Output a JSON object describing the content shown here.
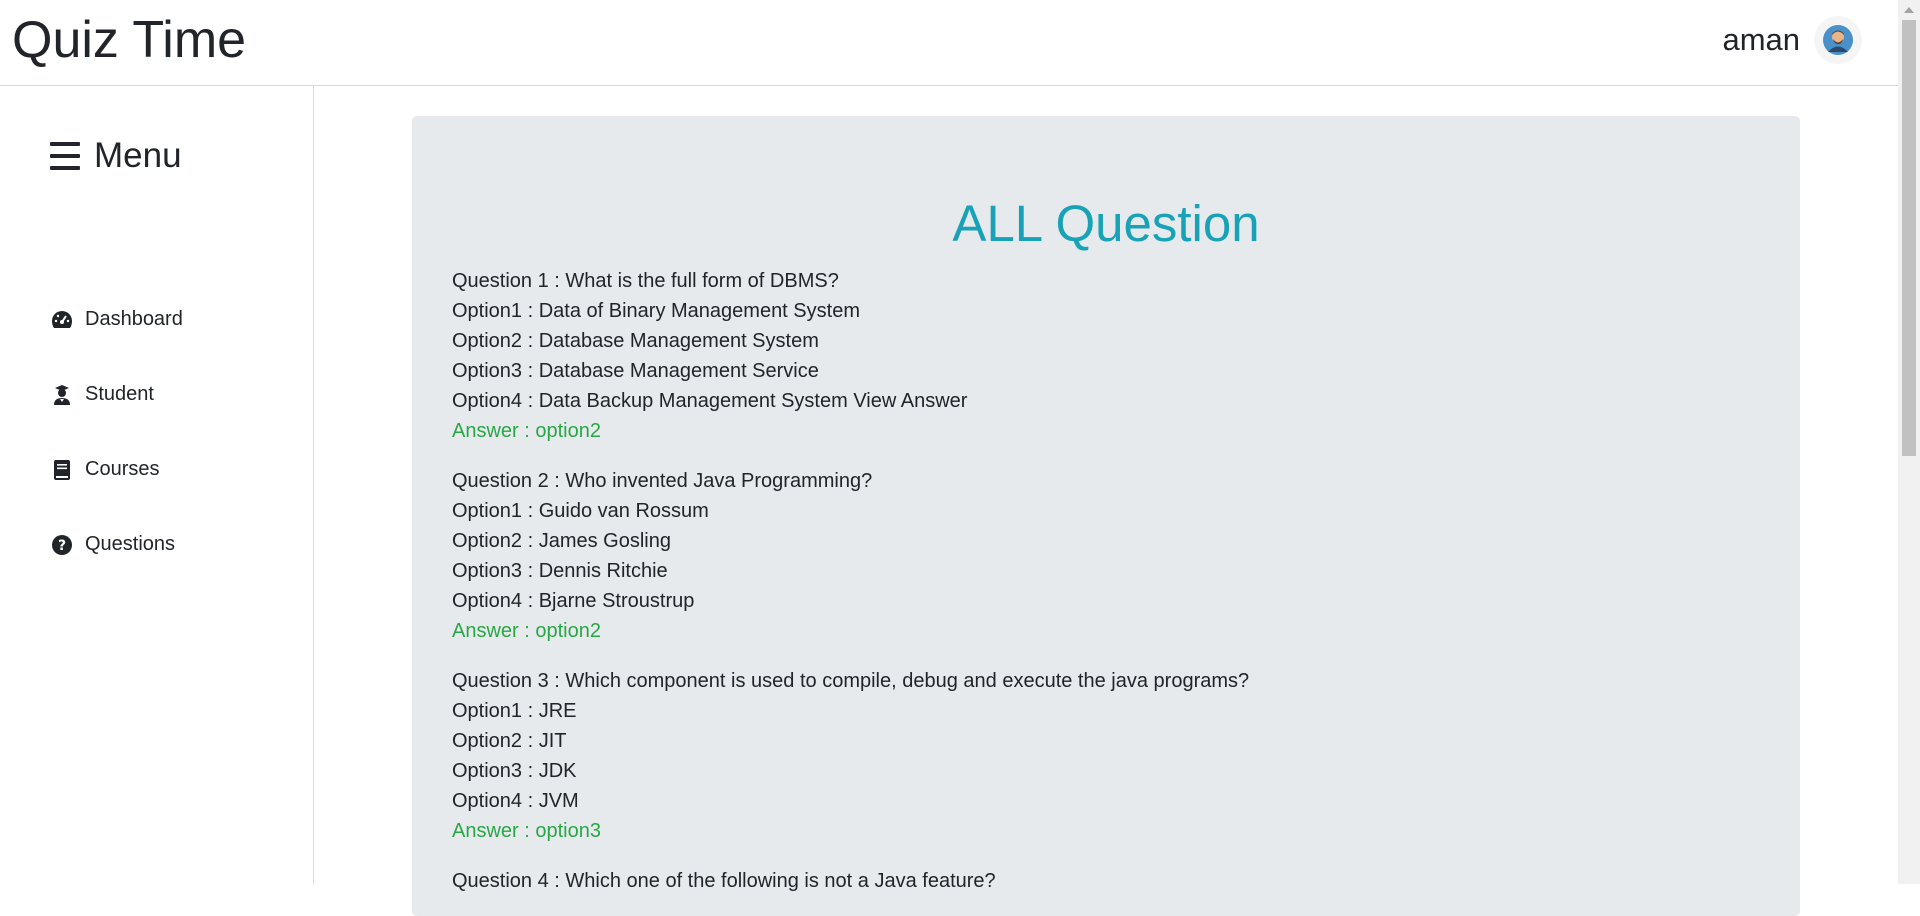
{
  "header": {
    "brand": "Quiz Time",
    "user_name": "aman",
    "avatar_icon": "user-avatar-icon"
  },
  "sidebar": {
    "menu_title": "Menu",
    "items": [
      {
        "label": "Dashboard",
        "icon": "tachometer-icon"
      },
      {
        "label": "Student",
        "icon": "user-graduate-icon"
      },
      {
        "label": "Courses",
        "icon": "book-icon"
      },
      {
        "label": "Questions",
        "icon": "question-circle-icon"
      }
    ]
  },
  "main": {
    "title": "ALL Question",
    "questions": [
      {
        "question": "Question 1 : What is the full form of DBMS?",
        "option1": "Option1 : Data of Binary Management System",
        "option2": "Option2 : Database Management System",
        "option3": "Option3 : Database Management Service",
        "option4": "Option4 : Data Backup Management System View Answer",
        "answer": "Answer : option2"
      },
      {
        "question": "Question 2 : Who invented Java Programming?",
        "option1": "Option1 : Guido van Rossum",
        "option2": "Option2 : James Gosling",
        "option3": "Option3 : Dennis Ritchie",
        "option4": "Option4 : Bjarne Stroustrup",
        "answer": "Answer : option2"
      },
      {
        "question": "Question 3 : Which component is used to compile, debug and execute the java programs?",
        "option1": "Option1 : JRE",
        "option2": "Option2 : JIT",
        "option3": "Option3 : JDK",
        "option4": "Option4 : JVM",
        "answer": "Answer : option3"
      },
      {
        "question": "Question 4 : Which one of the following is not a Java feature?"
      }
    ]
  },
  "colors": {
    "title": "#17a2b8",
    "answer": "#28a745",
    "card_bg": "#e7eaed"
  }
}
